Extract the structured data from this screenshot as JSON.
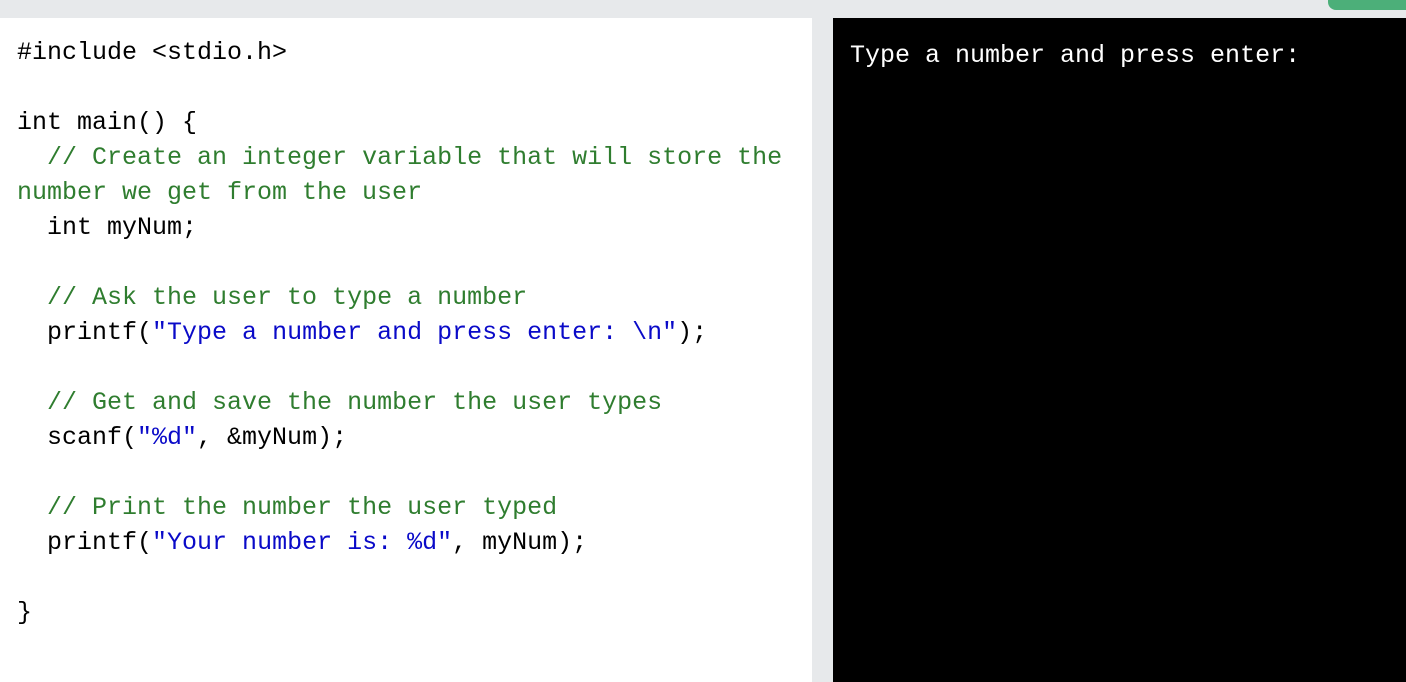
{
  "toolbar": {
    "run_button_color": "#4caf79"
  },
  "colors": {
    "comment": "#2f7d2f",
    "string": "#0a0ac8",
    "code": "#000000",
    "output_bg": "#000000",
    "output_text": "#ffffff"
  },
  "editor": {
    "lines": [
      [
        {
          "t": "#include <stdio.h>",
          "k": "plain"
        }
      ],
      [],
      [
        {
          "t": "int main() {",
          "k": "plain"
        }
      ],
      [
        {
          "t": "  ",
          "k": "plain"
        },
        {
          "t": "// Create an integer variable that will store the number we get from the user",
          "k": "comment"
        }
      ],
      [
        {
          "t": "  int myNum;",
          "k": "plain"
        }
      ],
      [],
      [
        {
          "t": "  ",
          "k": "plain"
        },
        {
          "t": "// Ask the user to type a number",
          "k": "comment"
        }
      ],
      [
        {
          "t": "  printf(",
          "k": "plain"
        },
        {
          "t": "\"Type a number and press enter: \\n\"",
          "k": "string"
        },
        {
          "t": ");",
          "k": "plain"
        }
      ],
      [],
      [
        {
          "t": "  ",
          "k": "plain"
        },
        {
          "t": "// Get and save the number the user types",
          "k": "comment"
        }
      ],
      [
        {
          "t": "  scanf(",
          "k": "plain"
        },
        {
          "t": "\"%d\"",
          "k": "string"
        },
        {
          "t": ", &myNum);",
          "k": "plain"
        }
      ],
      [],
      [
        {
          "t": "  ",
          "k": "plain"
        },
        {
          "t": "// Print the number the user typed",
          "k": "comment"
        }
      ],
      [
        {
          "t": "  printf(",
          "k": "plain"
        },
        {
          "t": "\"Your number is: %d\"",
          "k": "string"
        },
        {
          "t": ", myNum);",
          "k": "plain"
        }
      ],
      [],
      [
        {
          "t": "}",
          "k": "plain"
        }
      ]
    ]
  },
  "output": {
    "text": "Type a number and press enter:"
  }
}
